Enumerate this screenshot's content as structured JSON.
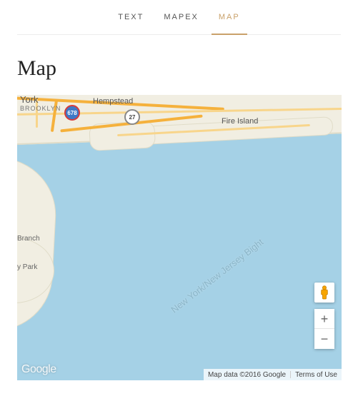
{
  "tabs": [
    {
      "label": "TEXT",
      "name": "tab-text",
      "active": false
    },
    {
      "label": "MAPEX",
      "name": "tab-mapex",
      "active": false
    },
    {
      "label": "MAP",
      "name": "tab-map",
      "active": true
    }
  ],
  "page_title": "Map",
  "map": {
    "labels": {
      "brooklyn": "BROOKLYN",
      "york": "York",
      "hempstead": "Hempstead",
      "fire_island": "Fire Island",
      "branch": "Branch",
      "park": "y Park",
      "ny_nj_bight": "New York/New Jersey Bight"
    },
    "shields": {
      "i678": "678",
      "r27": "27"
    },
    "logo": "Google",
    "attribution": {
      "map_data": "Map data ©2016 Google",
      "terms": "Terms of Use"
    },
    "controls": {
      "zoom_in": "+",
      "zoom_out": "−"
    }
  }
}
